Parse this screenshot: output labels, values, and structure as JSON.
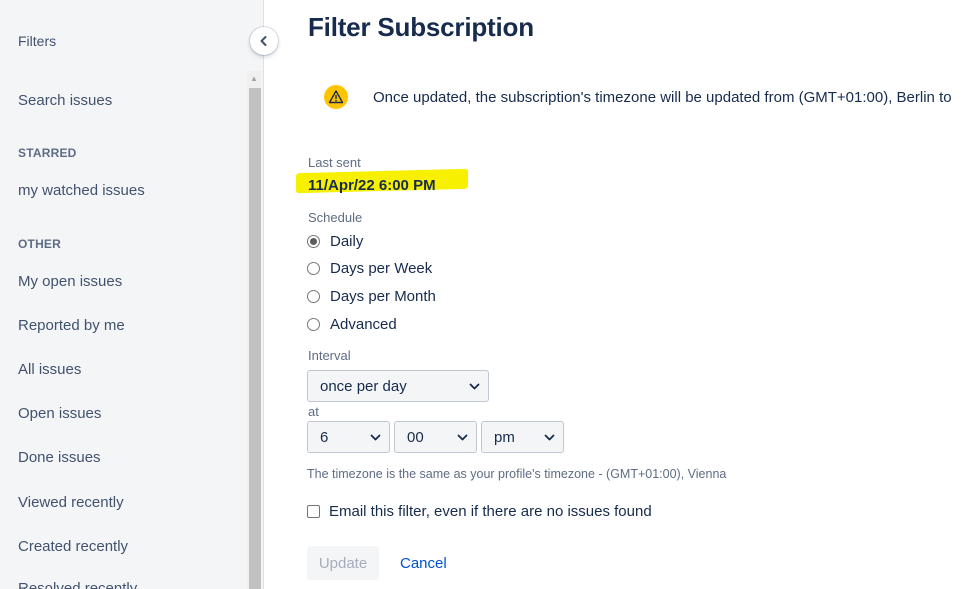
{
  "sidebar": {
    "title": "Filters",
    "search": "Search issues",
    "starred_heading": "STARRED",
    "starred_items": [
      "my watched issues"
    ],
    "other_heading": "OTHER",
    "other_items": [
      "My open issues",
      "Reported by me",
      "All issues",
      "Open issues",
      "Done issues",
      "Viewed recently",
      "Created recently",
      "Resolved recently"
    ]
  },
  "page": {
    "title": "Filter Subscription",
    "warning": "Once updated, the subscription's timezone will be updated from (GMT+01:00), Berlin to",
    "last_sent_label": "Last sent",
    "last_sent_value": "11/Apr/22 6:00 PM",
    "schedule_label": "Schedule",
    "schedule_options": [
      "Daily",
      "Days per Week",
      "Days per Month",
      "Advanced"
    ],
    "schedule_selected": "Daily",
    "interval_label": "Interval",
    "interval_value": "once per day",
    "at_label": "at",
    "hour_value": "6",
    "minute_value": "00",
    "ampm_value": "pm",
    "timezone_note": "The timezone is the same as your profile's timezone - (GMT+01:00), Vienna",
    "email_checkbox_label": "Email this filter, even if there are no issues found",
    "email_checkbox_checked": false,
    "update_label": "Update",
    "cancel_label": "Cancel"
  },
  "colors": {
    "highlight": "#f7f000",
    "link": "#0052cc",
    "warning": "#ffc400"
  }
}
